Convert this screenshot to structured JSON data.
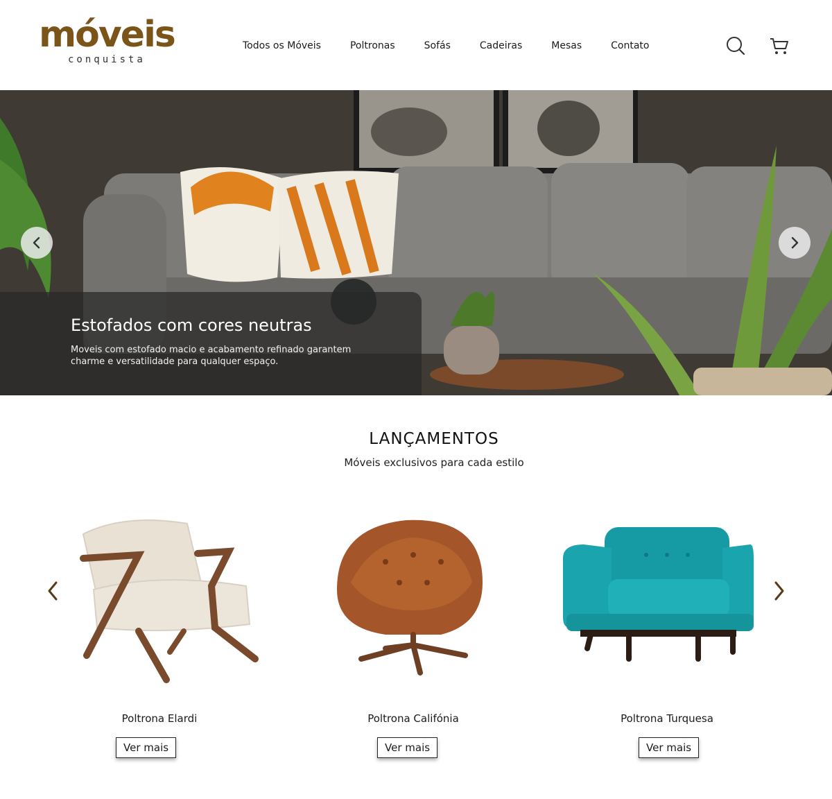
{
  "brand": {
    "name": "móveis",
    "tagline": "conquista",
    "color": "#7a5418"
  },
  "nav": {
    "items": [
      {
        "label": "Todos os Móveis"
      },
      {
        "label": "Poltronas"
      },
      {
        "label": "Sofás"
      },
      {
        "label": "Cadeiras"
      },
      {
        "label": "Mesas"
      },
      {
        "label": "Contato"
      }
    ],
    "icons": [
      "search-icon",
      "cart-icon"
    ]
  },
  "hero": {
    "title": "Estofados com cores neutras",
    "text": "Moveis com estofado macio e acabamento refinado garantem charme e versatilidade para qualquer espaço.",
    "arrows": [
      "chevron-left-icon",
      "chevron-right-icon"
    ]
  },
  "section": {
    "title": "LANÇAMENTOS",
    "subtitle": "Móveis exclusivos para cada estilo"
  },
  "products": [
    {
      "name": "Poltrona Elardi",
      "button": "Ver mais",
      "colors": {
        "fabric": "#e8e1d4",
        "wood": "#7a4a2c"
      }
    },
    {
      "name": "Poltrona Califónia",
      "button": "Ver mais",
      "colors": {
        "fabric": "#a5552a",
        "wood": "#6e3f22"
      }
    },
    {
      "name": "Poltrona Turquesa",
      "button": "Ver mais",
      "colors": {
        "fabric": "#1aa5ae",
        "wood": "#2c1d14"
      }
    }
  ]
}
